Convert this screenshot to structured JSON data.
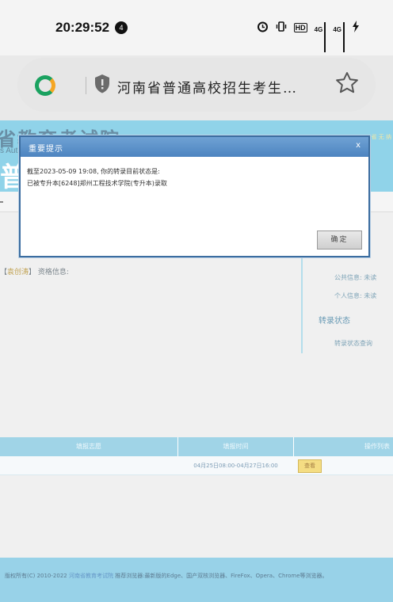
{
  "status_bar": {
    "time": "20:29:52",
    "notification_count": "4",
    "hd_label": "HD",
    "net_label_1": "4G",
    "net_label_2": "4G"
  },
  "browser": {
    "url_text": "河南省普通高校招生考生…"
  },
  "page": {
    "banner_title": "省教育考试院",
    "banner_subtitle": "s Auth",
    "banner_big": "普",
    "banner_right": "省  无  纳",
    "qualification_prefix": "【",
    "qualification_name": "袁创涛",
    "qualification_suffix": "】 资格信息:",
    "public_info": "公共信息: 未读",
    "personal_info": "个人信息: 未读",
    "section_heading": "转录状态",
    "status_query": "转录状态查询",
    "table_headers": [
      "填报志愿",
      "填报时间",
      "操作列表"
    ],
    "table_rows": [
      {
        "choice": "",
        "time": "04月25日08:00-04月27日16:00",
        "action": "查看"
      }
    ],
    "footer_prefix": "版权所有(C) 2010-2022",
    "footer_org": "河南省教育考试院",
    "footer_suffix": "   推荐浏览器:最新版的Edge、国产双核浏览器、FireFox、Opera、Chrome等浏览器。"
  },
  "dialog": {
    "title": "重要提示",
    "close_label": "x",
    "line1": "截至2023-05-09 19:08, 你的转录目前状态是:",
    "line2": "已被专升本[6248]郑州工程技术学院(专升本)录取",
    "ok_label": "确定"
  },
  "colors": {
    "banner": "#71c7e3",
    "dialog_title": "#4d84c0",
    "table_header": "#86c8e0",
    "view_button": "#f1d460"
  }
}
